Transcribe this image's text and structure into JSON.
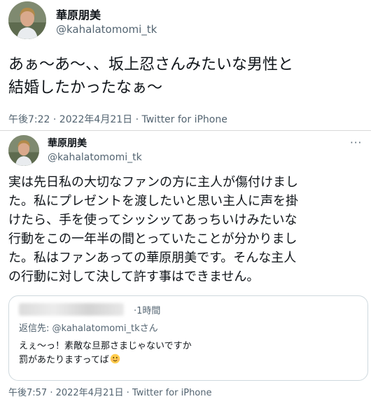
{
  "tweet1": {
    "display_name": "華原朋美",
    "handle": "@kahalatomomi_tk",
    "text": "あぁ〜あ〜、、坂上忍さんみたいな男性と\n結婚したかったなぁ〜",
    "time": "午後7:22 · 2022年4月21日",
    "sep": " · ",
    "source": "Twitter for iPhone"
  },
  "tweet2": {
    "display_name": "華原朋美",
    "handle": "@kahalatomomi_tk",
    "more": "···",
    "text": "実は先日私の大切なファンの方に主人が傷付けまし\nた。私にプレゼントを渡したいと思い主人に声を掛\nけたら、手を使ってシッシッてあっちいけみたいな\n行動をこの一年半の間とっていたことが分かりまし\nた。私はファンあっての華原朋美です。そんな主人\nの行動に対して決して許す事はできません。",
    "quoted": {
      "time": "·1時間",
      "reply_label": "返信先: ",
      "reply_handle": "@kahalatomomi_tkさん",
      "text": "えぇ〜っ！素敵な旦那さまじゃないですか\n罰があたりますってば",
      "emoji": "smiling-face-icon"
    },
    "time": "午後7:57 · 2022年4月21日",
    "sep": " · ",
    "source": "Twitter for iPhone"
  },
  "colors": {
    "text": "#0f1419",
    "secondary": "#536471",
    "border": "#cfd9de"
  }
}
